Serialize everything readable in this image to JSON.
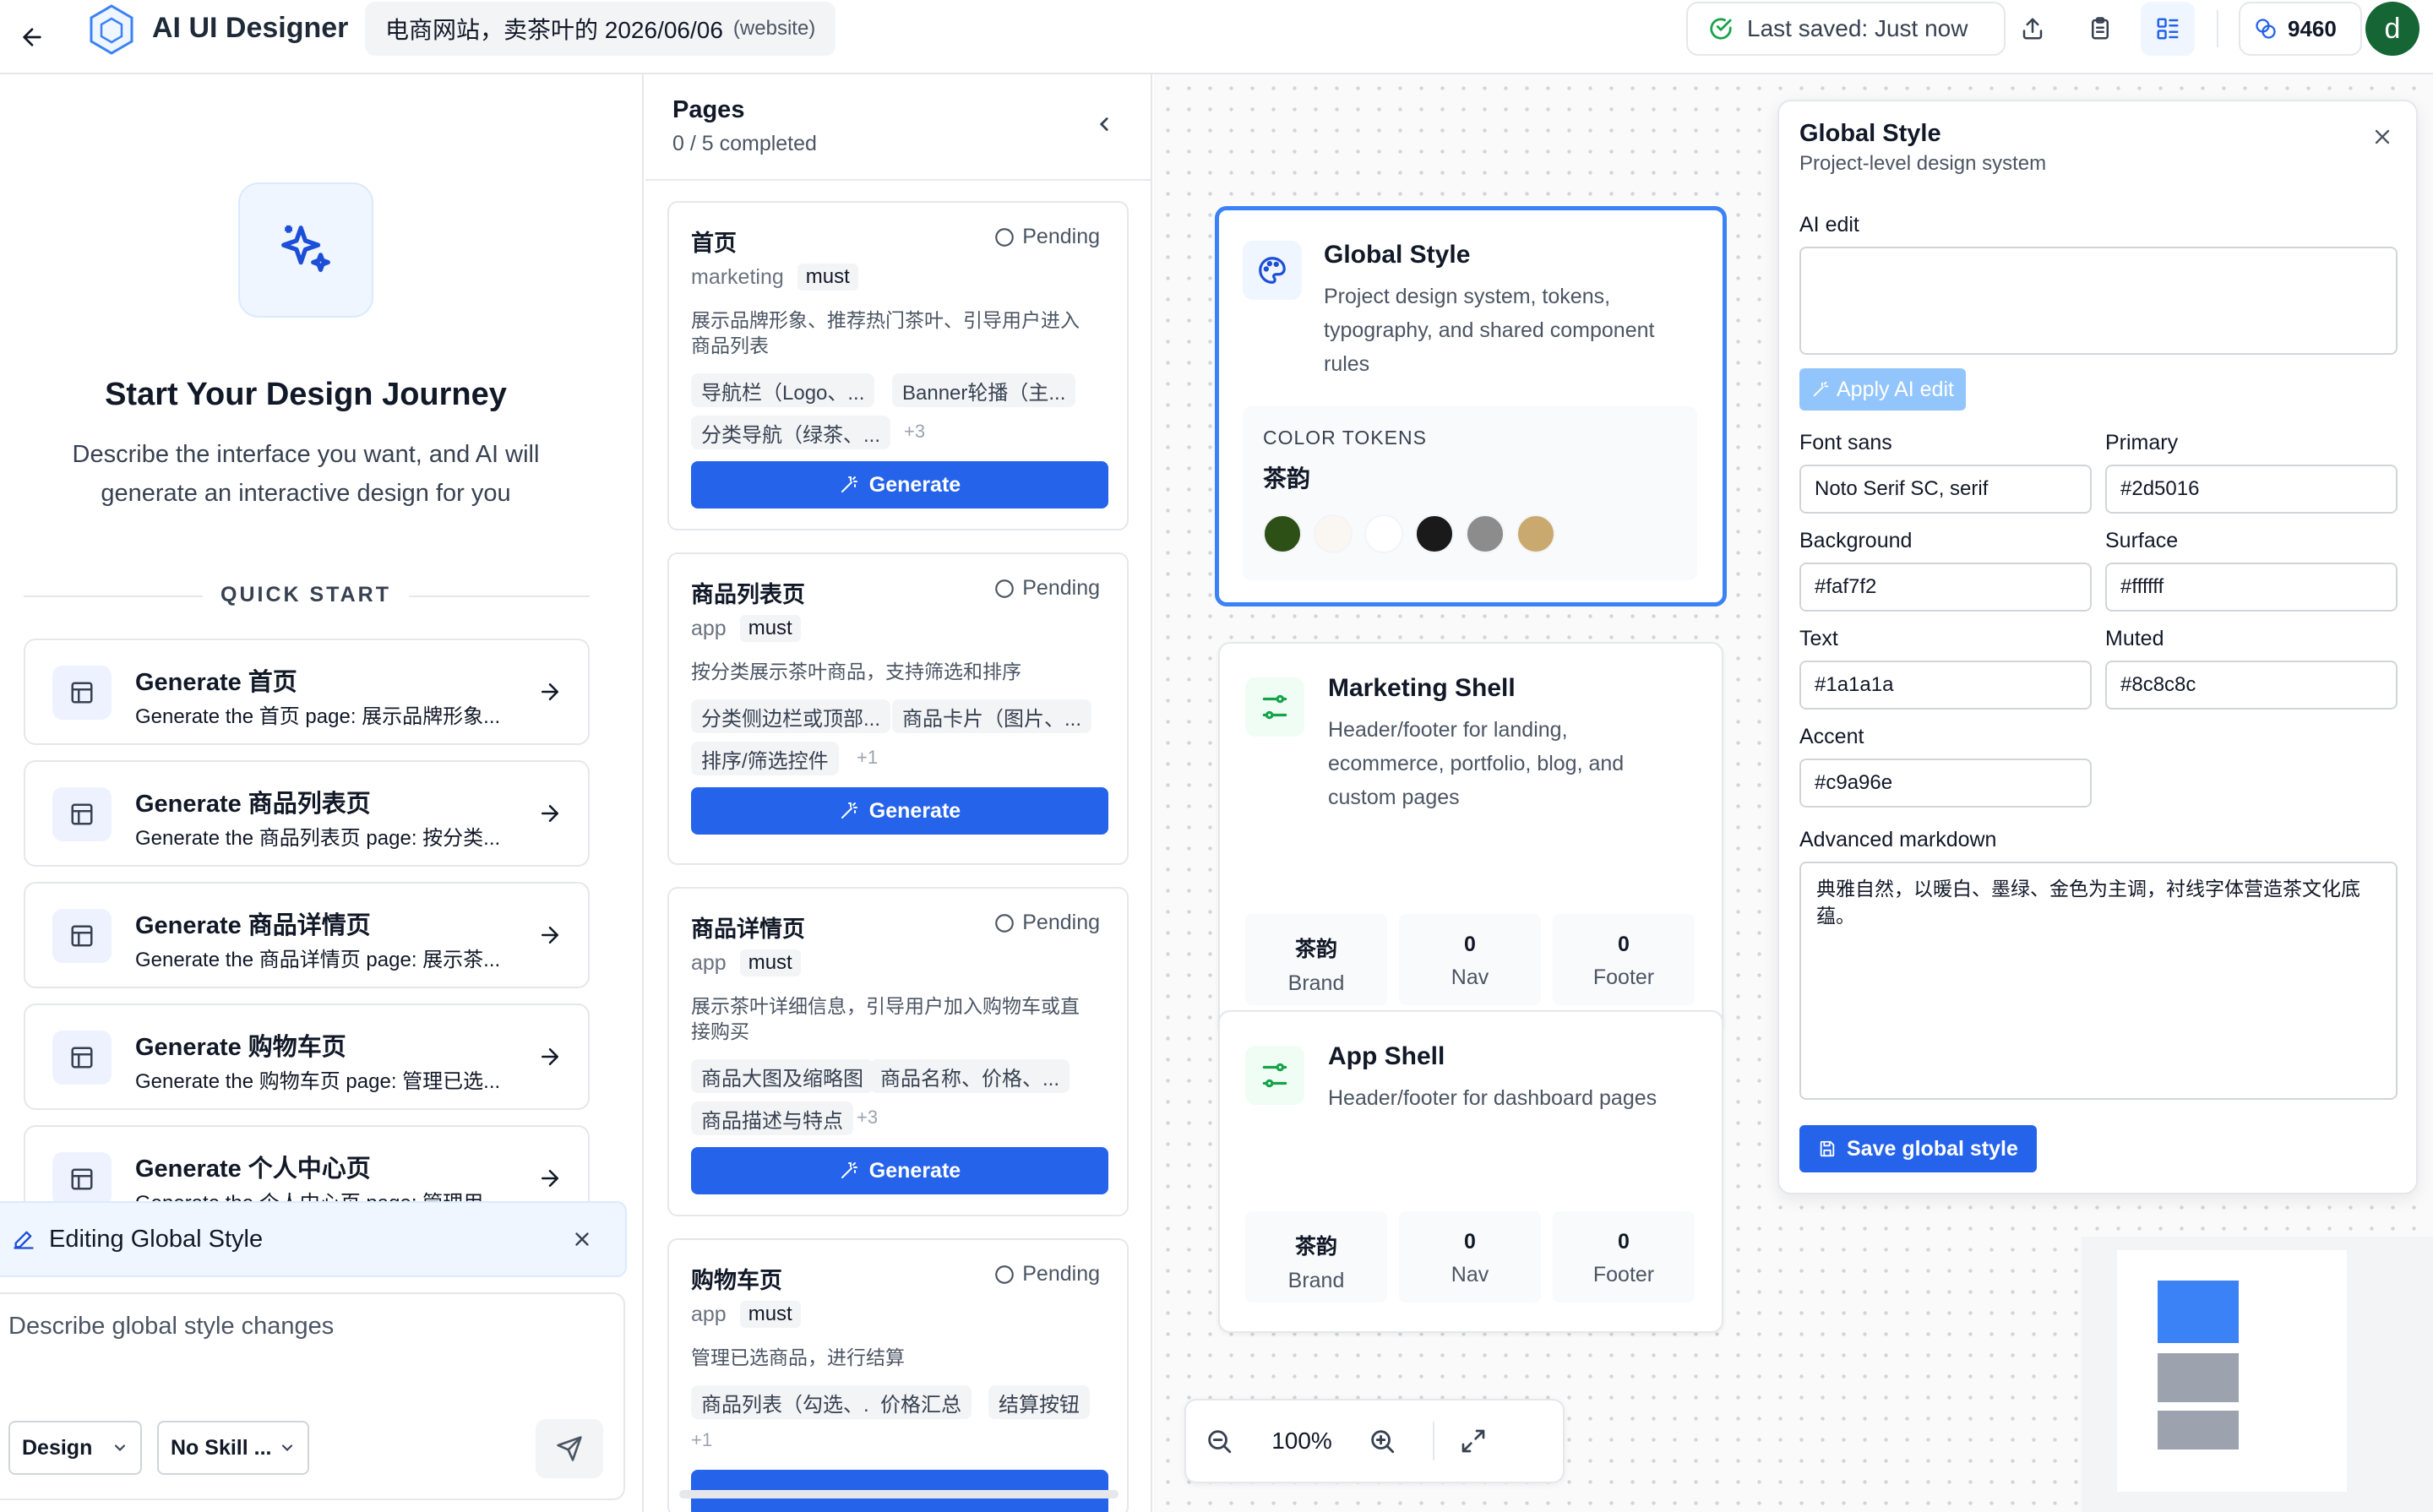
{
  "topbar": {
    "app_name": "AI UI Designer",
    "project_title": "电商网站，卖茶叶的 2026/06/06",
    "project_type": "(website)",
    "saved_status": "Last saved: Just now",
    "credits": "9460",
    "avatar_letter": "d",
    "icons": [
      "back-arrow-icon",
      "logo-hex-icon",
      "check-circle-icon",
      "share-icon",
      "clipboard-icon",
      "layout-grid-icon",
      "coins-icon"
    ]
  },
  "left": {
    "hero_title": "Start Your Design Journey",
    "hero_desc_1": "Describe the interface you want, and AI will",
    "hero_desc_2": "generate an interactive design for you",
    "quick_start_label": "QUICK START",
    "quick_start": [
      {
        "title": "Generate 首页",
        "sub": "Generate the 首页 page: 展示品牌形象..."
      },
      {
        "title": "Generate 商品列表页",
        "sub": "Generate the 商品列表页 page: 按分类..."
      },
      {
        "title": "Generate 商品详情页",
        "sub": "Generate the 商品详情页 page: 展示茶..."
      },
      {
        "title": "Generate 购物车页",
        "sub": "Generate the 购物车页 page: 管理已选..."
      },
      {
        "title": "Generate 个人中心页",
        "sub": "Generate the 个人中心页 page: 管理用..."
      }
    ],
    "editing_label": "Editing Global Style",
    "prompt_placeholder": "Describe global style changes",
    "mode_select": "Design",
    "skill_select": "No Skill ..."
  },
  "pages": {
    "title": "Pages",
    "progress": "0 / 5 completed",
    "generate_label": "Generate",
    "items": [
      {
        "title": "首页",
        "status": "Pending",
        "type": "marketing",
        "priority": "must",
        "desc_1": "展示品牌形象、推荐热门茶叶、引导用户进入",
        "desc_2": "商品列表",
        "chips": [
          "导航栏（Logo、...",
          "Banner轮播（主...",
          "分类导航（绿茶、..."
        ],
        "more": "+3"
      },
      {
        "title": "商品列表页",
        "status": "Pending",
        "type": "app",
        "priority": "must",
        "desc_1": "按分类展示茶叶商品，支持筛选和排序",
        "desc_2": "",
        "chips": [
          "分类侧边栏或顶部...",
          "商品卡片（图片、...",
          "排序/筛选控件"
        ],
        "more": "+1"
      },
      {
        "title": "商品详情页",
        "status": "Pending",
        "type": "app",
        "priority": "must",
        "desc_1": "展示茶叶详细信息，引导用户加入购物车或直",
        "desc_2": "接购买",
        "chips": [
          "商品大图及缩略图",
          "商品名称、价格、...",
          "商品描述与特点"
        ],
        "more": "+3"
      },
      {
        "title": "购物车页",
        "status": "Pending",
        "type": "app",
        "priority": "must",
        "desc_1": "管理已选商品，进行结算",
        "desc_2": "",
        "chips": [
          "商品列表（勾选、...",
          "价格汇总",
          "结算按钮"
        ],
        "more": "+1"
      }
    ]
  },
  "canvas": {
    "global_card": {
      "title": "Global Style",
      "desc_1": "Project design system, tokens,",
      "desc_2": "typography, and shared component",
      "desc_3": "rules",
      "tokens_label": "COLOR TOKENS",
      "tokens_name": "茶韵",
      "swatches": [
        "#2d5016",
        "#faf7f2",
        "#ffffff",
        "#1a1a1a",
        "#8c8c8c",
        "#c9a96e"
      ]
    },
    "marketing_shell": {
      "title": "Marketing Shell",
      "desc_1": "Header/footer for landing,",
      "desc_2": "ecommerce, portfolio, blog, and",
      "desc_3": "custom pages",
      "stats": [
        {
          "v": "茶韵",
          "l": "Brand"
        },
        {
          "v": "0",
          "l": "Nav"
        },
        {
          "v": "0",
          "l": "Footer"
        }
      ]
    },
    "app_shell": {
      "title": "App Shell",
      "desc_1": "Header/footer for dashboard pages",
      "stats": [
        {
          "v": "茶韵",
          "l": "Brand"
        },
        {
          "v": "0",
          "l": "Nav"
        },
        {
          "v": "0",
          "l": "Footer"
        }
      ]
    },
    "zoom": "100%"
  },
  "panel": {
    "title": "Global Style",
    "subtitle": "Project-level design system",
    "ai_edit_label": "AI edit",
    "ai_edit_value": "",
    "apply_label": "Apply AI edit",
    "fields": {
      "font_sans": {
        "label": "Font sans",
        "value": "Noto Serif SC, serif"
      },
      "primary": {
        "label": "Primary",
        "value": "#2d5016"
      },
      "background": {
        "label": "Background",
        "value": "#faf7f2"
      },
      "surface": {
        "label": "Surface",
        "value": "#ffffff"
      },
      "text": {
        "label": "Text",
        "value": "#1a1a1a"
      },
      "muted": {
        "label": "Muted",
        "value": "#8c8c8c"
      },
      "accent": {
        "label": "Accent",
        "value": "#c9a96e"
      }
    },
    "markdown_label": "Advanced markdown",
    "markdown_value": "典雅自然，以暖白、墨绿、金色为主调，衬线字体营造茶文化底蕴。",
    "save_label": "Save global style"
  },
  "colors": {
    "accent": "#2563eb",
    "success": "#16a34a"
  }
}
